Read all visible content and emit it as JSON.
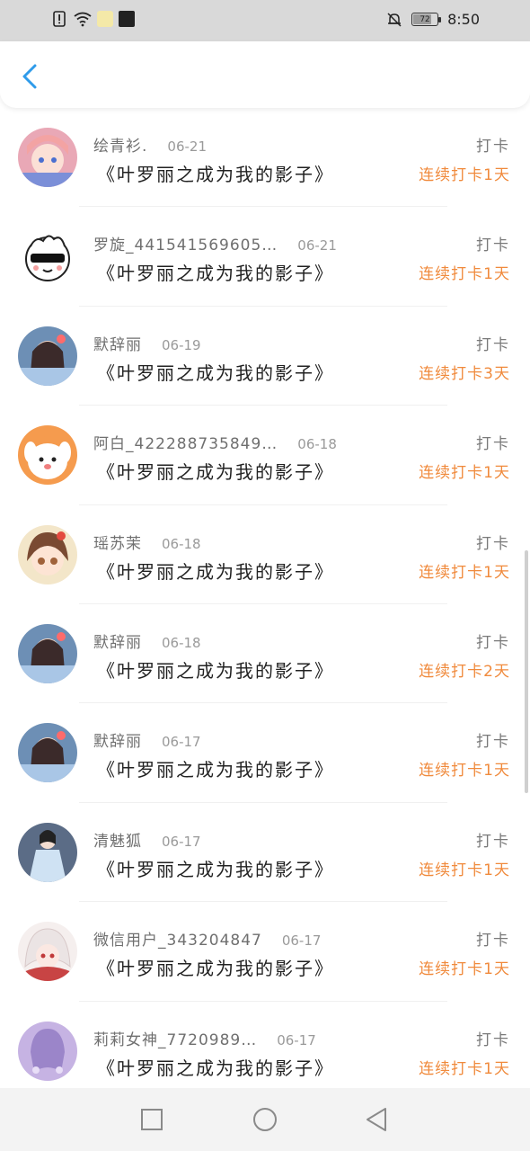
{
  "status_bar": {
    "time": "8:50",
    "battery": "72",
    "icons": [
      "alert-icon",
      "wifi-icon",
      "app-notification-icon",
      "app-notification-icon",
      "mute-icon",
      "battery-icon"
    ]
  },
  "header": {
    "back_icon": "chevron-left-icon"
  },
  "colors": {
    "accent": "#2f9bea",
    "streak": "#f08a3c",
    "status_bar_bg": "#d9d9d9",
    "nav_bar_bg": "#f3f3f3"
  },
  "list": [
    {
      "name": "绘青衫.",
      "date": "06-21",
      "title": "《叶罗丽之成为我的影子》",
      "action": "打卡",
      "streak": "连续打卡1天",
      "avatar": "anime-girl-pink-hair"
    },
    {
      "name": "罗旋_441541569605…",
      "date": "06-21",
      "title": "《叶罗丽之成为我的影子》",
      "action": "打卡",
      "streak": "连续打卡1天",
      "avatar": "cartoon-sunglasses"
    },
    {
      "name": "默辞丽",
      "date": "06-19",
      "title": "《叶罗丽之成为我的影子》",
      "action": "打卡",
      "streak": "连续打卡3天",
      "avatar": "anime-girl-blue-dress"
    },
    {
      "name": "阿白_422288735849…",
      "date": "06-18",
      "title": "《叶罗丽之成为我的影子》",
      "action": "打卡",
      "streak": "连续打卡1天",
      "avatar": "cartoon-white-dog"
    },
    {
      "name": "瑶苏茉",
      "date": "06-18",
      "title": "《叶罗丽之成为我的影子》",
      "action": "打卡",
      "streak": "连续打卡1天",
      "avatar": "anime-girl-brown-hair"
    },
    {
      "name": "默辞丽",
      "date": "06-18",
      "title": "《叶罗丽之成为我的影子》",
      "action": "打卡",
      "streak": "连续打卡2天",
      "avatar": "anime-girl-blue-dress"
    },
    {
      "name": "默辞丽",
      "date": "06-17",
      "title": "《叶罗丽之成为我的影子》",
      "action": "打卡",
      "streak": "连续打卡1天",
      "avatar": "anime-girl-blue-dress"
    },
    {
      "name": "清魅狐",
      "date": "06-17",
      "title": "《叶罗丽之成为我的影子》",
      "action": "打卡",
      "streak": "连续打卡1天",
      "avatar": "anime-girl-light-blue-robe"
    },
    {
      "name": "微信用户_343204847",
      "date": "06-17",
      "title": "《叶罗丽之成为我的影子》",
      "action": "打卡",
      "streak": "连续打卡1天",
      "avatar": "anime-girl-white-hair"
    },
    {
      "name": "莉莉女神_7720989…",
      "date": "06-17",
      "title": "《叶罗丽之成为我的影子》",
      "action": "打卡",
      "streak": "连续打卡1天",
      "avatar": "anime-girl-purple"
    }
  ],
  "nav_bar": {
    "icons": [
      "recent-apps-icon",
      "home-icon",
      "back-icon"
    ]
  }
}
